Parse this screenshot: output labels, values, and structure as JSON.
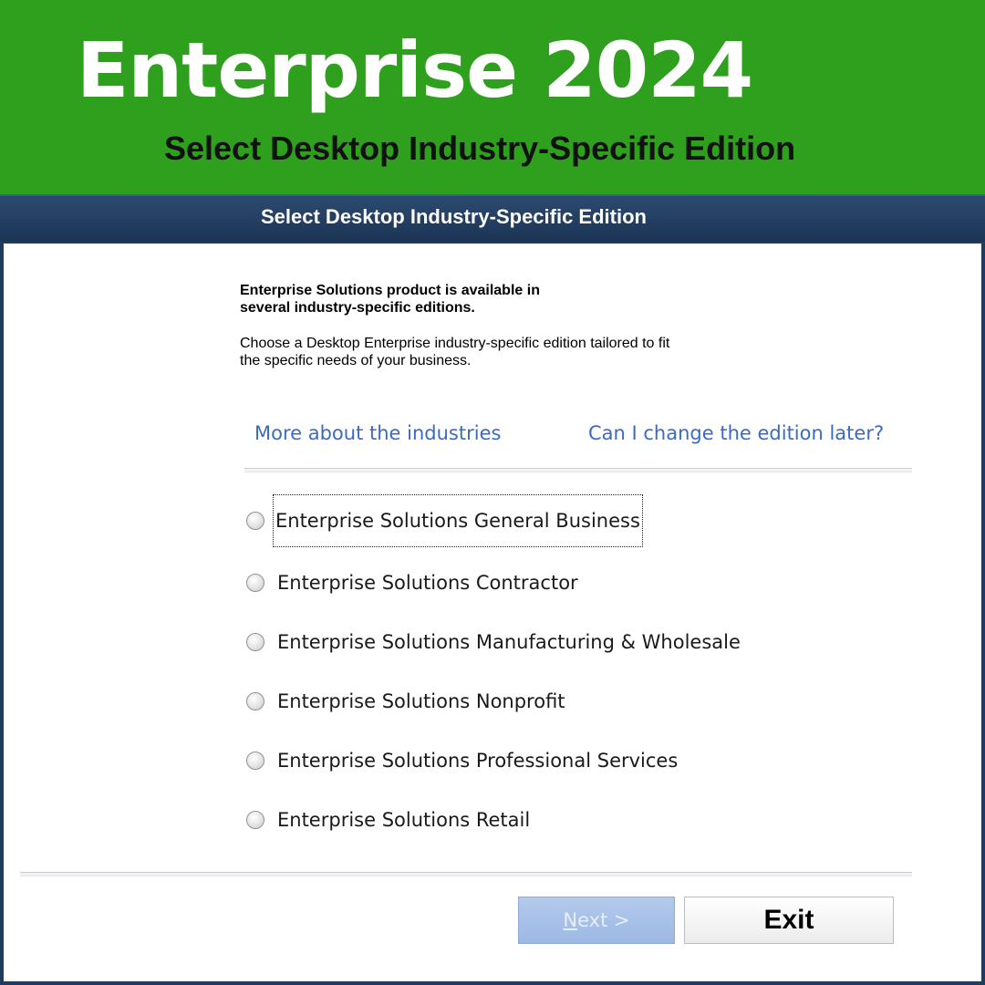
{
  "banner": {
    "title": "Enterprise 2024",
    "subtitle": "Select  Desktop Industry-Specific Edition",
    "background_color": "#2fa01e"
  },
  "dialog": {
    "title": "Select  Desktop Industry-Specific Edition",
    "intro_bold_line1": "Enterprise Solutions product is available in",
    "intro_bold_line2": "several industry-specific editions.",
    "intro_line1": "Choose a Desktop Enterprise  industry-specific edition tailored to fit",
    "intro_line2": "the specific needs of your business.",
    "links": {
      "industries": "More about the industries",
      "change_edition": "Can I change the edition later?"
    },
    "options": [
      {
        "label": "Enterprise Solutions General Business",
        "selected": false,
        "focused": true
      },
      {
        "label": "Enterprise Solutions Contractor",
        "selected": false
      },
      {
        "label": "Enterprise Solutions Manufacturing & Wholesale",
        "selected": false
      },
      {
        "label": "Enterprise Solutions Nonprofit",
        "selected": false
      },
      {
        "label": "Enterprise Solutions Professional Services",
        "selected": false
      },
      {
        "label": "Enterprise Solutions Retail",
        "selected": false
      }
    ],
    "buttons": {
      "next_underlined": "N",
      "next_rest": "ext >",
      "next_enabled": false,
      "exit": "Exit"
    },
    "link_color": "#3a6bc4",
    "titlebar_color": "#1f3b5e"
  }
}
